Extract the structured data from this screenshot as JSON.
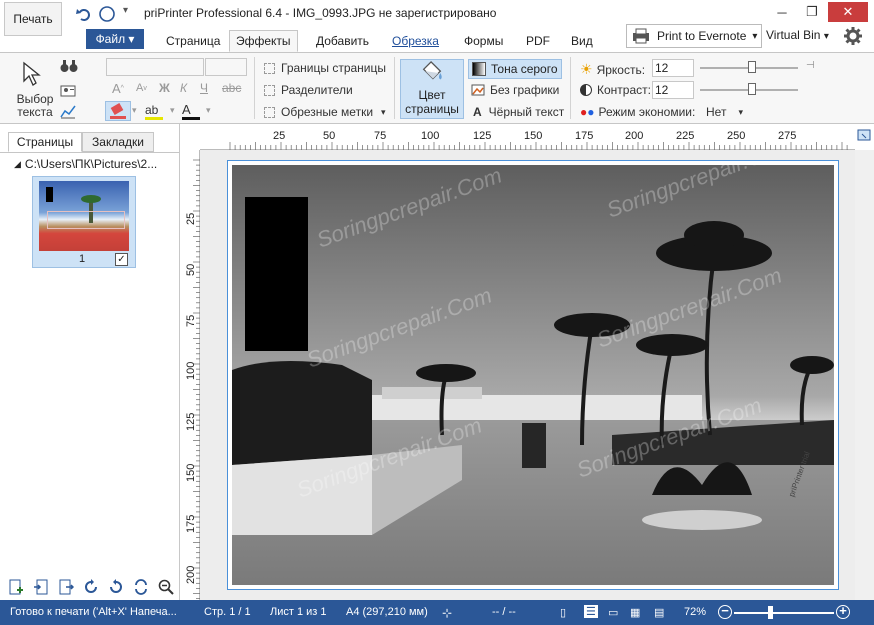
{
  "app": {
    "title": "priPrinter Professional 6.4 - IMG_0993.JPG не зарегистрировано",
    "print_button": "Печать"
  },
  "ribbon_tabs": [
    {
      "label": "Файл"
    },
    {
      "label": "Страница"
    },
    {
      "label": "Эффекты"
    },
    {
      "label": "Добавить"
    },
    {
      "label": "Обрезка"
    },
    {
      "label": "Формы"
    },
    {
      "label": "PDF"
    },
    {
      "label": "Вид"
    }
  ],
  "printer": {
    "name": "Print to Evernote",
    "tray": "Virtual Bin"
  },
  "ribbon": {
    "select_text_label": "Выбор текста",
    "page_borders": "Границы страницы",
    "separators": "Разделители",
    "crop_marks": "Обрезные метки",
    "page_color": "Цвет страницы",
    "grayscale": "Тона серого",
    "no_graphics": "Без графики",
    "black_text": "Чёрный текст",
    "brightness_label": "Яркость:",
    "brightness_value": "12",
    "contrast_label": "Контраст:",
    "contrast_value": "12",
    "economy_label": "Режим экономии:",
    "economy_value": "Нет",
    "bold_glyph": "Ж",
    "italic_glyph": "К",
    "underline_glyph": "Ч"
  },
  "panel": {
    "tab_pages": "Страницы",
    "tab_bookmarks": "Закладки",
    "tree_path": "C:\\Users\\ПК\\Pictures\\2...",
    "thumb_number": "1"
  },
  "ruler": {
    "h_ticks": [
      "25",
      "50",
      "75",
      "100",
      "125",
      "150",
      "175",
      "200",
      "225",
      "250",
      "275"
    ],
    "v_ticks": [
      "25",
      "50",
      "75",
      "100",
      "125",
      "150",
      "175",
      "200"
    ]
  },
  "watermarks": [
    "Soringpcrepair.Com"
  ],
  "status": {
    "ready": "Готово к печати ('Alt+X' Напеча...",
    "page": "Стр. 1 / 1",
    "sheet": "Лист 1 из 1",
    "paper": "A4 (297,210 мм)",
    "coords": "-- / --",
    "zoom": "72%"
  },
  "colors": {
    "accent": "#2b5797",
    "selection": "#cde2f6",
    "close": "#c93d3d"
  }
}
